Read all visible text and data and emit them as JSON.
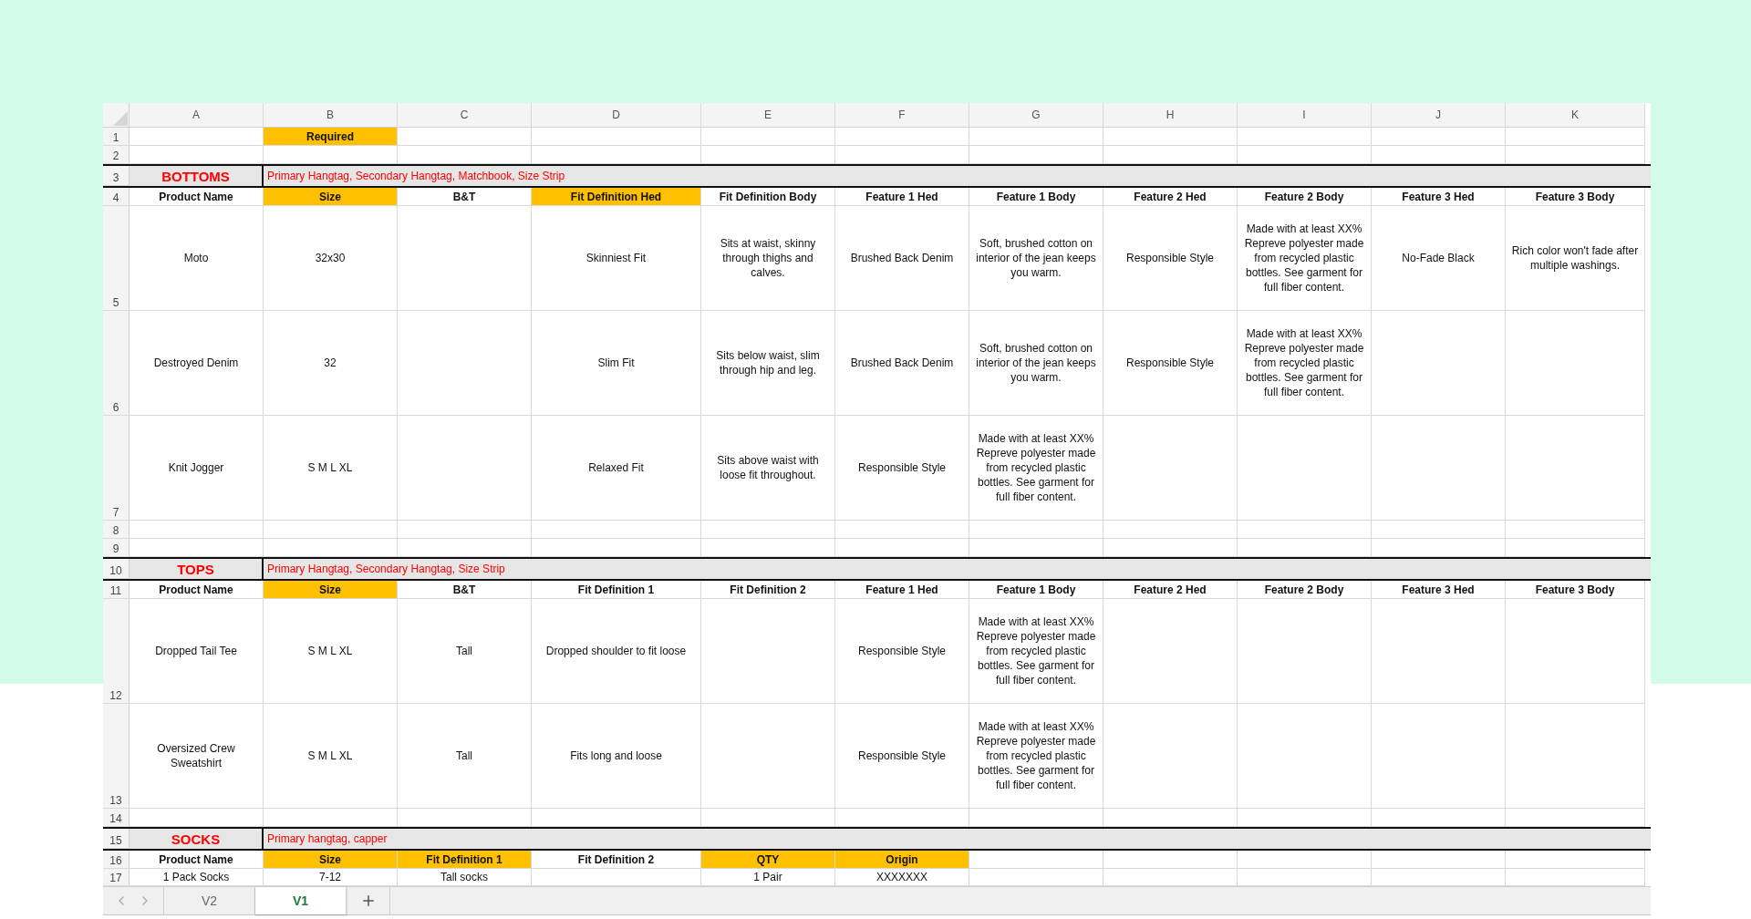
{
  "column_headers": [
    "A",
    "B",
    "C",
    "D",
    "E",
    "F",
    "G",
    "H",
    "I",
    "J",
    "K"
  ],
  "rows": [
    {
      "number": "1",
      "kind": "header",
      "cells": [
        {},
        {
          "text": "Required",
          "highlighted": true
        },
        {},
        {},
        {},
        {},
        {},
        {},
        {},
        {},
        {}
      ]
    },
    {
      "number": "2",
      "kind": "blank"
    },
    {
      "number": "3",
      "kind": "section",
      "title": "BOTTOMS",
      "note": "Primary Hangtag, Secondary Hangtag, Matchbook, Size Strip"
    },
    {
      "number": "4",
      "kind": "header",
      "cells": [
        {
          "text": "Product Name",
          "highlighted": false
        },
        {
          "text": "Size",
          "highlighted": true
        },
        {
          "text": "B&T",
          "highlighted": false
        },
        {
          "text": "Fit Definition Hed",
          "highlighted": true
        },
        {
          "text": "Fit Definition Body",
          "highlighted": false
        },
        {
          "text": "Feature 1 Hed",
          "highlighted": false
        },
        {
          "text": "Feature 1 Body",
          "highlighted": false
        },
        {
          "text": "Feature 2 Hed",
          "highlighted": false
        },
        {
          "text": "Feature 2 Body",
          "highlighted": false
        },
        {
          "text": "Feature 3 Hed",
          "highlighted": false
        },
        {
          "text": "Feature 3 Body",
          "highlighted": false
        }
      ]
    },
    {
      "number": "5",
      "kind": "entry",
      "cells": [
        {
          "text": "Moto"
        },
        {
          "text": "32x30"
        },
        {},
        {
          "text": "Skinniest Fit"
        },
        {
          "text": "Sits at waist, skinny through thighs and calves."
        },
        {
          "text": "Brushed Back Denim"
        },
        {
          "text": "Soft, brushed cotton on interior of the jean keeps you warm."
        },
        {
          "text": "Responsible Style"
        },
        {
          "text": "Made with at least XX% Repreve polyester made from recycled plastic bottles. See garment for full fiber content."
        },
        {
          "text": "No-Fade Black"
        },
        {
          "text": "Rich color won't fade after multiple washings."
        }
      ]
    },
    {
      "number": "6",
      "kind": "entry",
      "cells": [
        {
          "text": "Destroyed Denim"
        },
        {
          "text": "32"
        },
        {},
        {
          "text": "Slim Fit"
        },
        {
          "text": "Sits below waist, slim through hip and leg."
        },
        {
          "text": "Brushed Back Denim"
        },
        {
          "text": "Soft, brushed cotton on interior of the jean keeps you warm."
        },
        {
          "text": "Responsible Style"
        },
        {
          "text": "Made with at least XX% Repreve polyester made from recycled plastic bottles. See garment for full fiber content."
        },
        {},
        {}
      ]
    },
    {
      "number": "7",
      "kind": "entry",
      "cells": [
        {
          "text": "Knit Jogger"
        },
        {
          "text": "S M L XL"
        },
        {},
        {
          "text": "Relaxed Fit"
        },
        {
          "text": "Sits above waist with loose fit throughout."
        },
        {
          "text": "Responsible Style"
        },
        {
          "text": "Made with at least XX% Repreve polyester made from recycled plastic bottles. See garment for full fiber content."
        },
        {},
        {},
        {},
        {}
      ]
    },
    {
      "number": "8",
      "kind": "blank"
    },
    {
      "number": "9",
      "kind": "blank"
    },
    {
      "number": "10",
      "kind": "section",
      "title": "TOPS",
      "note": "Primary Hangtag, Secondary Hangtag, Size Strip"
    },
    {
      "number": "11",
      "kind": "header",
      "cells": [
        {
          "text": "Product Name",
          "highlighted": false
        },
        {
          "text": "Size",
          "highlighted": true
        },
        {
          "text": "B&T",
          "highlighted": false
        },
        {
          "text": "Fit Definition 1",
          "highlighted": false
        },
        {
          "text": "Fit Definition 2",
          "highlighted": false
        },
        {
          "text": "Feature 1 Hed",
          "highlighted": false
        },
        {
          "text": "Feature 1 Body",
          "highlighted": false
        },
        {
          "text": "Feature 2 Hed",
          "highlighted": false
        },
        {
          "text": "Feature 2 Body",
          "highlighted": false
        },
        {
          "text": "Feature 3 Hed",
          "highlighted": false
        },
        {
          "text": "Feature 3 Body",
          "highlighted": false
        }
      ]
    },
    {
      "number": "12",
      "kind": "entry",
      "cells": [
        {
          "text": "Dropped Tail Tee"
        },
        {
          "text": "S M L XL"
        },
        {
          "text": "Tall"
        },
        {
          "text": "Dropped shoulder to fit loose"
        },
        {},
        {
          "text": "Responsible Style"
        },
        {
          "text": "Made with at least XX% Repreve polyester made from recycled plastic bottles. See garment for full fiber content."
        },
        {},
        {},
        {},
        {}
      ]
    },
    {
      "number": "13",
      "kind": "entry",
      "cells": [
        {
          "text": "Oversized Crew Sweatshirt"
        },
        {
          "text": "S M L XL"
        },
        {
          "text": "Tall"
        },
        {
          "text": "Fits long and loose"
        },
        {},
        {
          "text": "Responsible Style"
        },
        {
          "text": "Made with at least XX% Repreve polyester made from recycled plastic bottles. See garment for full fiber content."
        },
        {},
        {},
        {},
        {}
      ]
    },
    {
      "number": "14",
      "kind": "blank"
    },
    {
      "number": "15",
      "kind": "section",
      "title": "SOCKS",
      "note": "Primary hangtag, capper"
    },
    {
      "number": "16",
      "kind": "header",
      "cells": [
        {
          "text": "Product Name",
          "highlighted": false
        },
        {
          "text": "Size",
          "highlighted": true
        },
        {
          "text": "Fit Definition 1",
          "highlighted": true
        },
        {
          "text": "Fit Definition 2",
          "highlighted": false
        },
        {
          "text": "QTY",
          "highlighted": true
        },
        {
          "text": "Origin",
          "highlighted": true
        },
        {},
        {},
        {},
        {},
        {}
      ]
    },
    {
      "number": "17",
      "kind": "line",
      "cells": [
        {
          "text": "1 Pack Socks"
        },
        {
          "text": "7-12"
        },
        {
          "text": "Tall socks"
        },
        {},
        {
          "text": "1 Pair"
        },
        {
          "text": "XXXXXXX"
        },
        {},
        {},
        {},
        {},
        {}
      ]
    }
  ],
  "sheet_tabs": [
    {
      "label": "V2",
      "selected": false
    },
    {
      "label": "V1",
      "selected": true
    }
  ]
}
